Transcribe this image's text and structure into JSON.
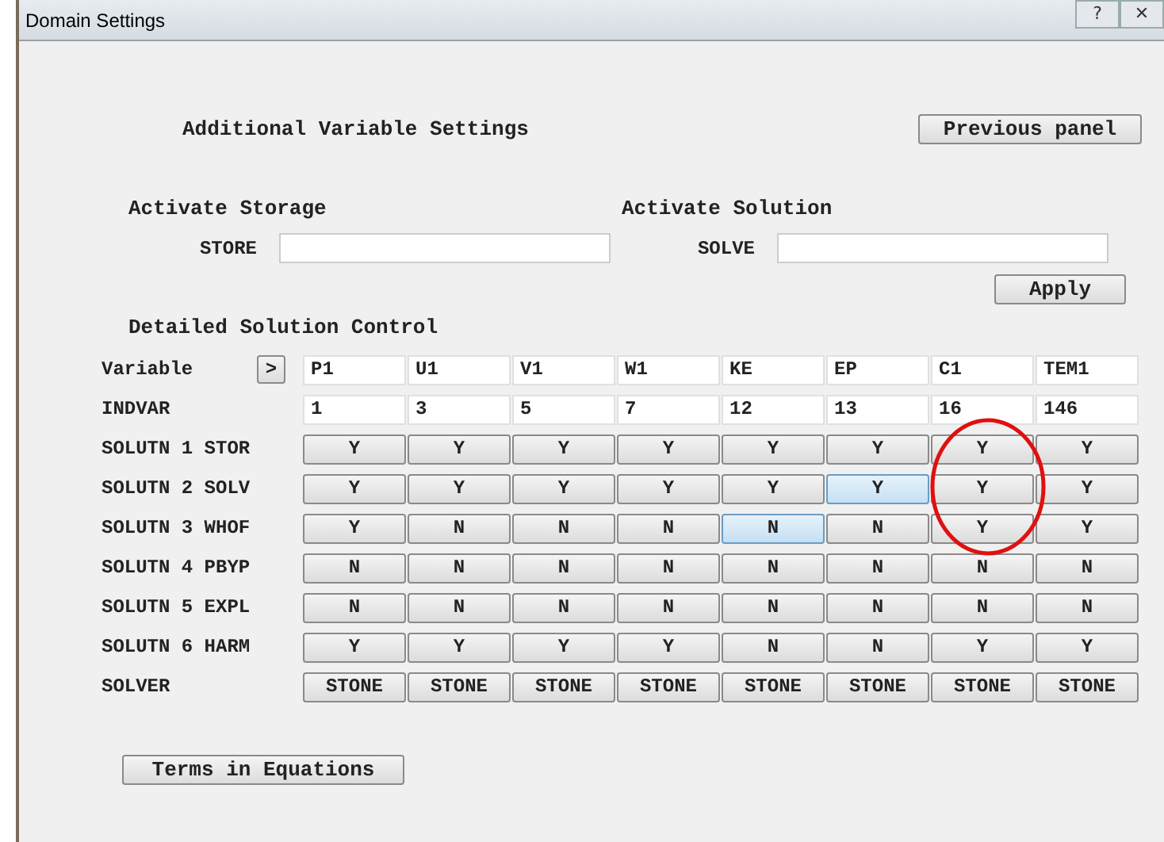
{
  "window": {
    "title": "Domain Settings",
    "buttons": [
      "?",
      "✕"
    ]
  },
  "heading": "Additional Variable Settings",
  "previous_button": "Previous panel",
  "storage": {
    "title": "Activate Storage",
    "label": "STORE"
  },
  "solution": {
    "title": "Activate Solution",
    "label": "SOLVE"
  },
  "apply_button": "Apply",
  "section_title": "Detailed Solution Control",
  "variable_row": {
    "label": "Variable",
    "next_button": ">",
    "values": [
      "P1",
      "U1",
      "V1",
      "W1",
      "KE",
      "EP",
      "C1",
      "TEM1"
    ]
  },
  "indvar_row": {
    "label": "INDVAR",
    "values": [
      "1",
      "3",
      "5",
      "7",
      "12",
      "13",
      "16",
      "146"
    ]
  },
  "toggle_rows": [
    {
      "label": "SOLUTN 1 STOR",
      "cells": [
        {
          "text": "Y",
          "highlighted": false
        },
        {
          "text": "Y",
          "highlighted": false
        },
        {
          "text": "Y",
          "highlighted": false
        },
        {
          "text": "Y",
          "highlighted": false
        },
        {
          "text": "Y",
          "highlighted": false
        },
        {
          "text": "Y",
          "highlighted": false
        },
        {
          "text": "Y",
          "highlighted": false
        },
        {
          "text": "Y",
          "highlighted": false
        }
      ]
    },
    {
      "label": "SOLUTN 2 SOLV",
      "cells": [
        {
          "text": "Y",
          "highlighted": false
        },
        {
          "text": "Y",
          "highlighted": false
        },
        {
          "text": "Y",
          "highlighted": false
        },
        {
          "text": "Y",
          "highlighted": false
        },
        {
          "text": "Y",
          "highlighted": false
        },
        {
          "text": "Y",
          "highlighted": true
        },
        {
          "text": "Y",
          "highlighted": false
        },
        {
          "text": "Y",
          "highlighted": false
        }
      ]
    },
    {
      "label": "SOLUTN 3 WHOF",
      "cells": [
        {
          "text": "Y",
          "highlighted": false
        },
        {
          "text": "N",
          "highlighted": false
        },
        {
          "text": "N",
          "highlighted": false
        },
        {
          "text": "N",
          "highlighted": false
        },
        {
          "text": "N",
          "highlighted": true
        },
        {
          "text": "N",
          "highlighted": false
        },
        {
          "text": "Y",
          "highlighted": false
        },
        {
          "text": "Y",
          "highlighted": false
        }
      ]
    },
    {
      "label": "SOLUTN 4 PBYP",
      "cells": [
        {
          "text": "N",
          "highlighted": false
        },
        {
          "text": "N",
          "highlighted": false
        },
        {
          "text": "N",
          "highlighted": false
        },
        {
          "text": "N",
          "highlighted": false
        },
        {
          "text": "N",
          "highlighted": false
        },
        {
          "text": "N",
          "highlighted": false
        },
        {
          "text": "N",
          "highlighted": false
        },
        {
          "text": "N",
          "highlighted": false
        }
      ]
    },
    {
      "label": "SOLUTN 5 EXPL",
      "cells": [
        {
          "text": "N",
          "highlighted": false
        },
        {
          "text": "N",
          "highlighted": false
        },
        {
          "text": "N",
          "highlighted": false
        },
        {
          "text": "N",
          "highlighted": false
        },
        {
          "text": "N",
          "highlighted": false
        },
        {
          "text": "N",
          "highlighted": false
        },
        {
          "text": "N",
          "highlighted": false
        },
        {
          "text": "N",
          "highlighted": false
        }
      ]
    },
    {
      "label": "SOLUTN 6 HARM",
      "cells": [
        {
          "text": "Y",
          "highlighted": false
        },
        {
          "text": "Y",
          "highlighted": false
        },
        {
          "text": "Y",
          "highlighted": false
        },
        {
          "text": "Y",
          "highlighted": false
        },
        {
          "text": "N",
          "highlighted": false
        },
        {
          "text": "N",
          "highlighted": false
        },
        {
          "text": "Y",
          "highlighted": false
        },
        {
          "text": "Y",
          "highlighted": false
        }
      ]
    },
    {
      "label": "SOLVER",
      "cells": [
        {
          "text": "STONE",
          "highlighted": false
        },
        {
          "text": "STONE",
          "highlighted": false
        },
        {
          "text": "STONE",
          "highlighted": false
        },
        {
          "text": "STONE",
          "highlighted": false
        },
        {
          "text": "STONE",
          "highlighted": false
        },
        {
          "text": "STONE",
          "highlighted": false
        },
        {
          "text": "STONE",
          "highlighted": false
        },
        {
          "text": "STONE",
          "highlighted": false
        }
      ]
    }
  ],
  "terms_button": "Terms in Equations"
}
